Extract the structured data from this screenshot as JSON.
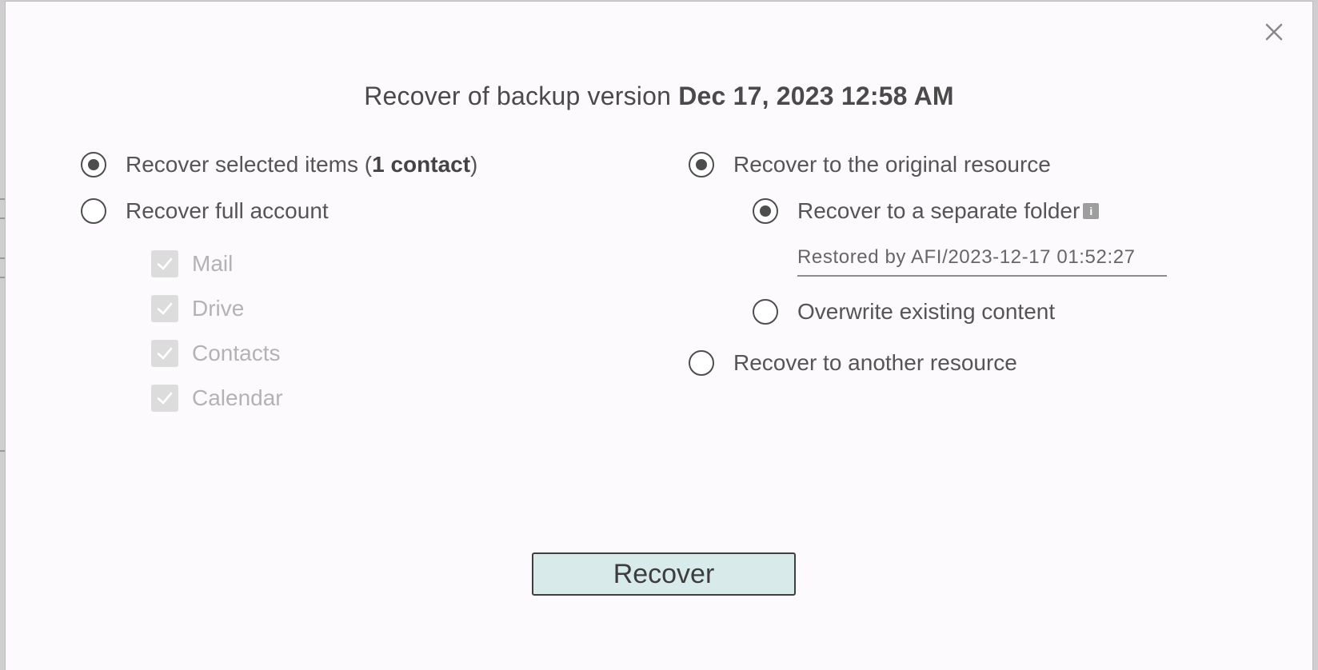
{
  "dialog": {
    "close_label": "×",
    "title_prefix": "Recover of backup version ",
    "title_version": "Dec 17, 2023 12:58 AM"
  },
  "scope": {
    "selected_items": {
      "label_prefix": "Recover selected items (",
      "label_count": "1 contact",
      "label_suffix": ")",
      "checked": true
    },
    "full_account": {
      "label": "Recover full account",
      "checked": false
    },
    "categories": [
      {
        "label": "Mail",
        "checked": true,
        "disabled": true
      },
      {
        "label": "Drive",
        "checked": true,
        "disabled": true
      },
      {
        "label": "Contacts",
        "checked": true,
        "disabled": true
      },
      {
        "label": "Calendar",
        "checked": true,
        "disabled": true
      }
    ]
  },
  "destination": {
    "original_resource": {
      "label": "Recover to the original resource",
      "checked": true
    },
    "separate_folder": {
      "label": "Recover to a separate folder",
      "checked": true,
      "info_icon": "info-icon",
      "folder_value": "Restored by AFI/2023-12-17 01:52:27"
    },
    "overwrite": {
      "label": "Overwrite existing content",
      "checked": false
    },
    "another_resource": {
      "label": "Recover to another resource",
      "checked": false
    }
  },
  "actions": {
    "recover_label": "Recover"
  },
  "colors": {
    "button_bg": "#d8eaea",
    "dialog_bg": "#fdfafd",
    "radio": "#4d4d4d",
    "disabled_checkbox": "#dcdcdc"
  }
}
